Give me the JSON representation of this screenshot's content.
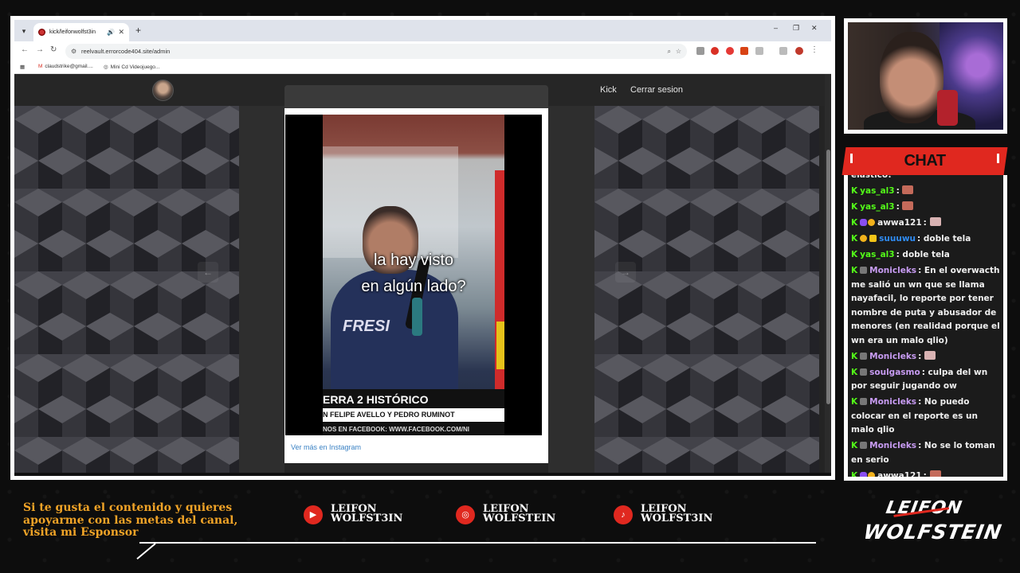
{
  "browser": {
    "tab": {
      "title": "kick/leifonwolfst3in"
    },
    "url": "reelvault.errorcode404.site/admin",
    "bookmarks": [
      {
        "label": "claudstrike@gmail...."
      },
      {
        "label": "Mini Cd Videojuego..."
      }
    ]
  },
  "site": {
    "nav": {
      "kick": "Kick",
      "logout": "Cerrar sesion"
    }
  },
  "post": {
    "caption_line1": "la hay visto",
    "caption_line2": "en algún lado?",
    "lower_title": "ERRA 2 HISTÓRICO",
    "lower_names": "N FELIPE AVELLO Y PEDRO RUMINOT",
    "lower_web": "NOS EN FACEBOOK: WWW.FACEBOOK.COM/NI",
    "shirt": "FRESI",
    "instagram_link": "Ver más en Instagram"
  },
  "chat": {
    "title": "CHAT",
    "partial_text": "elastico!",
    "messages": [
      {
        "user": "yas_al3",
        "text": "",
        "user_color": "#53fc18",
        "badges": [
          "k"
        ],
        "emote": "face"
      },
      {
        "user": "yas_al3",
        "text": "",
        "user_color": "#53fc18",
        "badges": [
          "k"
        ],
        "emote": "face"
      },
      {
        "user": "awwa121",
        "text": "",
        "user_color": "#f0f0f0",
        "badges": [
          "k",
          "sub",
          "gift"
        ],
        "emote": "cry"
      },
      {
        "user": "suuuwu",
        "text": "doble tela",
        "user_color": "#2f8cf5",
        "badges": [
          "k",
          "gift",
          "og"
        ]
      },
      {
        "user": "yas_al3",
        "text": "doble tela",
        "user_color": "#53fc18",
        "badges": [
          "k"
        ]
      },
      {
        "user": "Monicleks",
        "text": "En el overwacth me salió un wn que se llama nayafacil, lo reporte por tener nombre de puta y abusador de menores (en realidad porque el wn era un malo qlio)",
        "user_color": "#c79bf2",
        "badges": [
          "k",
          "bot"
        ]
      },
      {
        "user": "Monicleks",
        "text": "",
        "user_color": "#c79bf2",
        "badges": [
          "k",
          "bot"
        ],
        "emote": "cry"
      },
      {
        "user": "soulgasmo",
        "text": "culpa del wn por seguir jugando ow",
        "user_color": "#c79bf2",
        "badges": [
          "k",
          "bot"
        ]
      },
      {
        "user": "Monicleks",
        "text": "No puedo colocar en el reporte es un malo qlio",
        "user_color": "#c79bf2",
        "badges": [
          "k",
          "bot"
        ]
      },
      {
        "user": "Monicleks",
        "text": "No se lo toman en serio",
        "user_color": "#c79bf2",
        "badges": [
          "k",
          "bot"
        ]
      },
      {
        "user": "awwa121",
        "text": "",
        "user_color": "#f0f0f0",
        "badges": [
          "k",
          "sub",
          "gift"
        ],
        "emote": "face"
      }
    ]
  },
  "overlay": {
    "sponsor_text": "Si te gusta el contenido y quieres apoyarme con las metas del canal, visita mi Esponsor",
    "socials": [
      {
        "platform": "youtube",
        "icon": "youtube-icon",
        "line1": "LEIFON",
        "line2": "WOLFST3IN"
      },
      {
        "platform": "instagram",
        "icon": "instagram-icon",
        "line1": "LEIFON",
        "line2": "WOLFSTEIN"
      },
      {
        "platform": "tiktok",
        "icon": "tiktok-icon",
        "line1": "LEIFON",
        "line2": "WOLFST3IN"
      }
    ],
    "brand_line1": "LEIFON",
    "brand_line2": "WOLFSTEIN"
  },
  "colors": {
    "accent_red": "#e0281f",
    "kick_green": "#53fc18",
    "sponsor_orange": "#f0a327",
    "link_blue": "#3b82c4"
  }
}
